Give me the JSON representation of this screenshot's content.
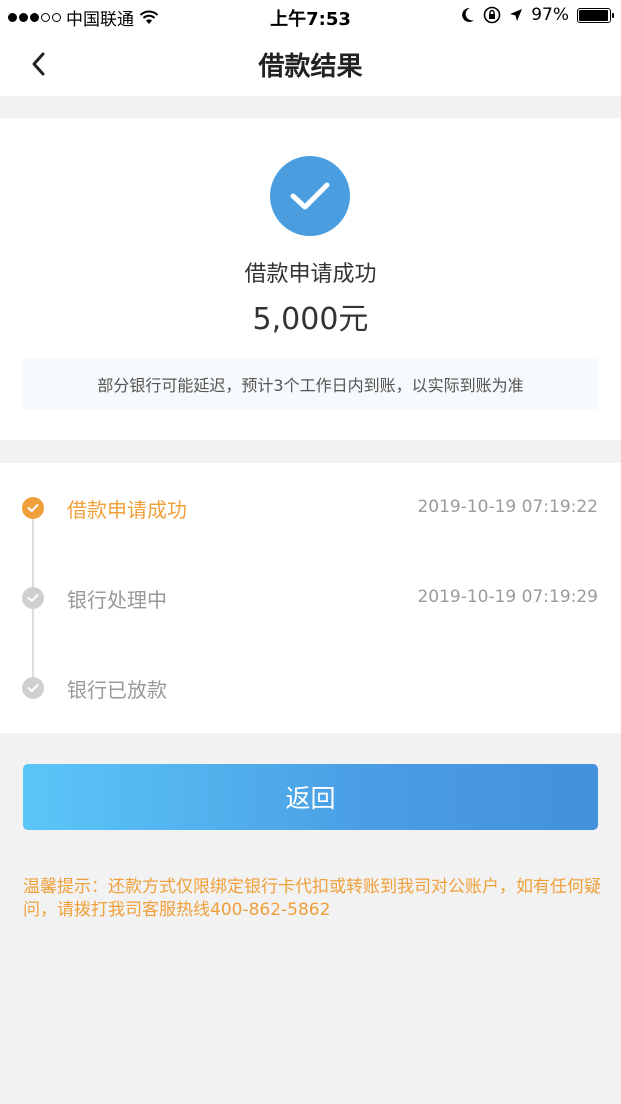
{
  "status_bar": {
    "carrier": "中国联通",
    "time": "上午7:53",
    "battery": "97%",
    "battery_level": 0.97
  },
  "nav": {
    "title": "借款结果"
  },
  "result": {
    "title": "借款申请成功",
    "amount": "5,000元",
    "notice": "部分银行可能延迟，预计3个工作日内到账，以实际到账为准"
  },
  "timeline": {
    "steps": [
      {
        "label": "借款申请成功",
        "time": "2019-10-19 07:19:22",
        "state": "done"
      },
      {
        "label": "银行处理中",
        "time": "2019-10-19 07:19:29",
        "state": "pending"
      },
      {
        "label": "银行已放款",
        "time": "",
        "state": "pending"
      }
    ]
  },
  "actions": {
    "return_label": "返回"
  },
  "tip": "温馨提示：还款方式仅限绑定银行卡代扣或转账到我司对公账户，如有任何疑问，请拨打我司客服热线400-862-5862",
  "colors": {
    "accent_blue": "#4a9ee0",
    "done_orange": "#f0a03a",
    "pending_gray": "#cfcfcf"
  }
}
